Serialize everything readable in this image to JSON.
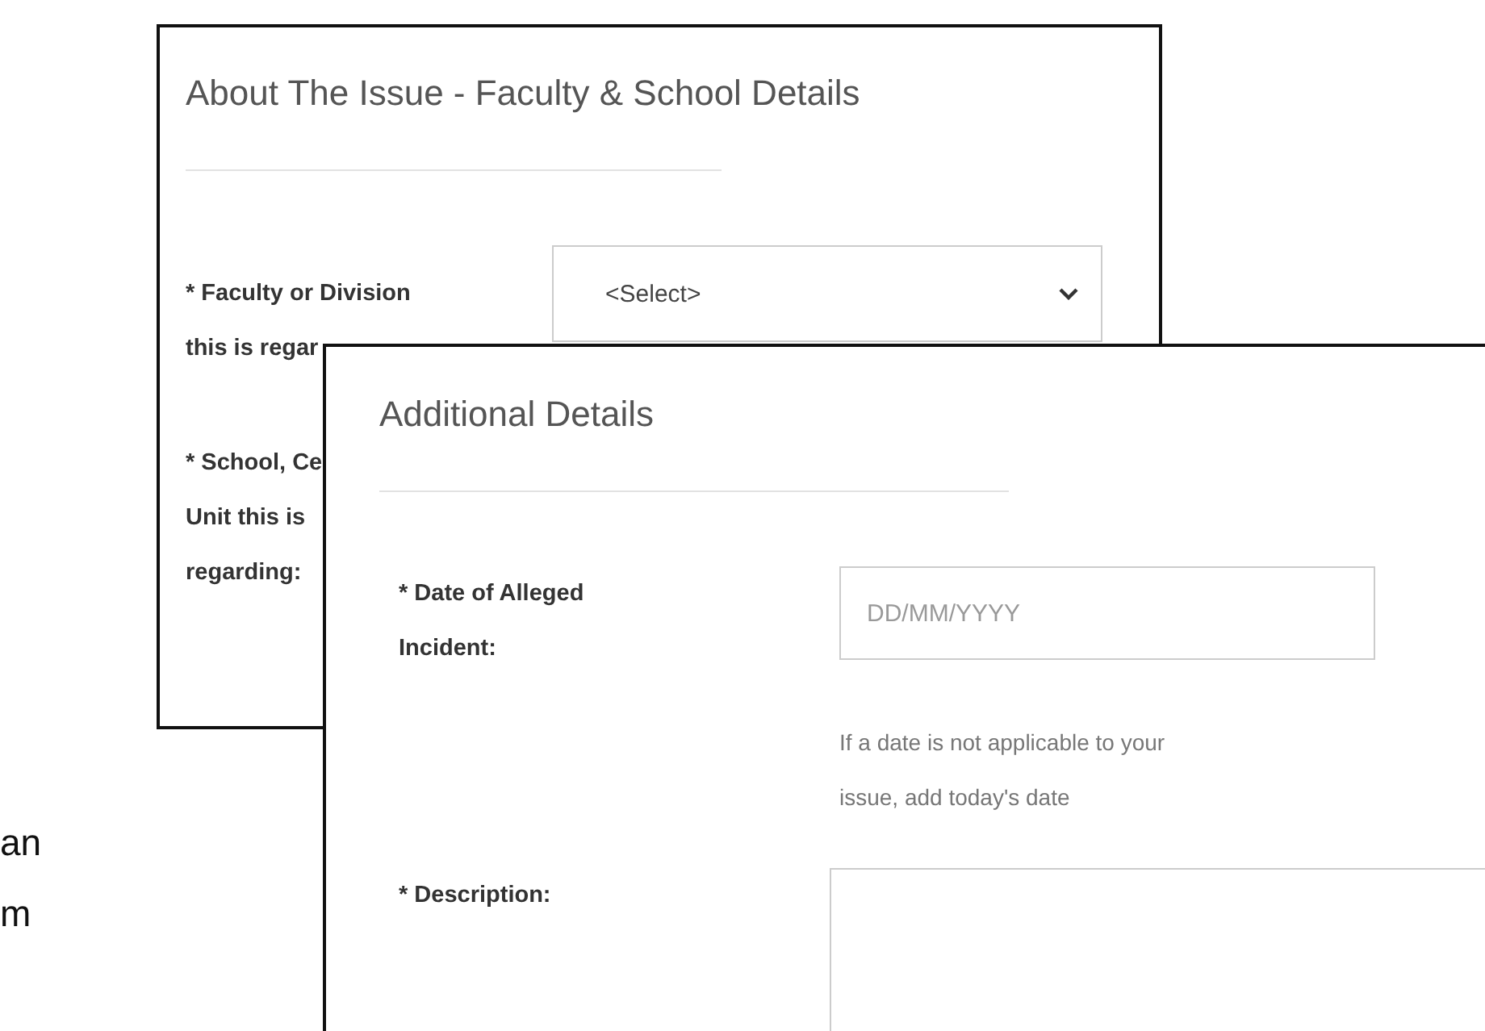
{
  "background_text": {
    "lines": [
      "an",
      "m"
    ]
  },
  "faculty_panel": {
    "title": "About The Issue - Faculty & School Details",
    "fields": [
      {
        "label_lines": [
          "* Faculty or Division",
          "this is regar"
        ],
        "kind": "select",
        "value": "<Select>"
      },
      {
        "label_lines": [
          "* School, Ce",
          "Unit this is",
          "regarding:"
        ],
        "kind": "none"
      }
    ]
  },
  "details_panel": {
    "title": "Additional Details",
    "fields": [
      {
        "label_lines": [
          "* Date of Alleged",
          "Incident:"
        ],
        "kind": "text",
        "placeholder": "DD/MM/YYYY",
        "help_lines": [
          "If a date is not applicable to your",
          "issue, add today's date"
        ]
      },
      {
        "label_lines": [
          "* Description:"
        ],
        "kind": "textarea"
      }
    ]
  }
}
